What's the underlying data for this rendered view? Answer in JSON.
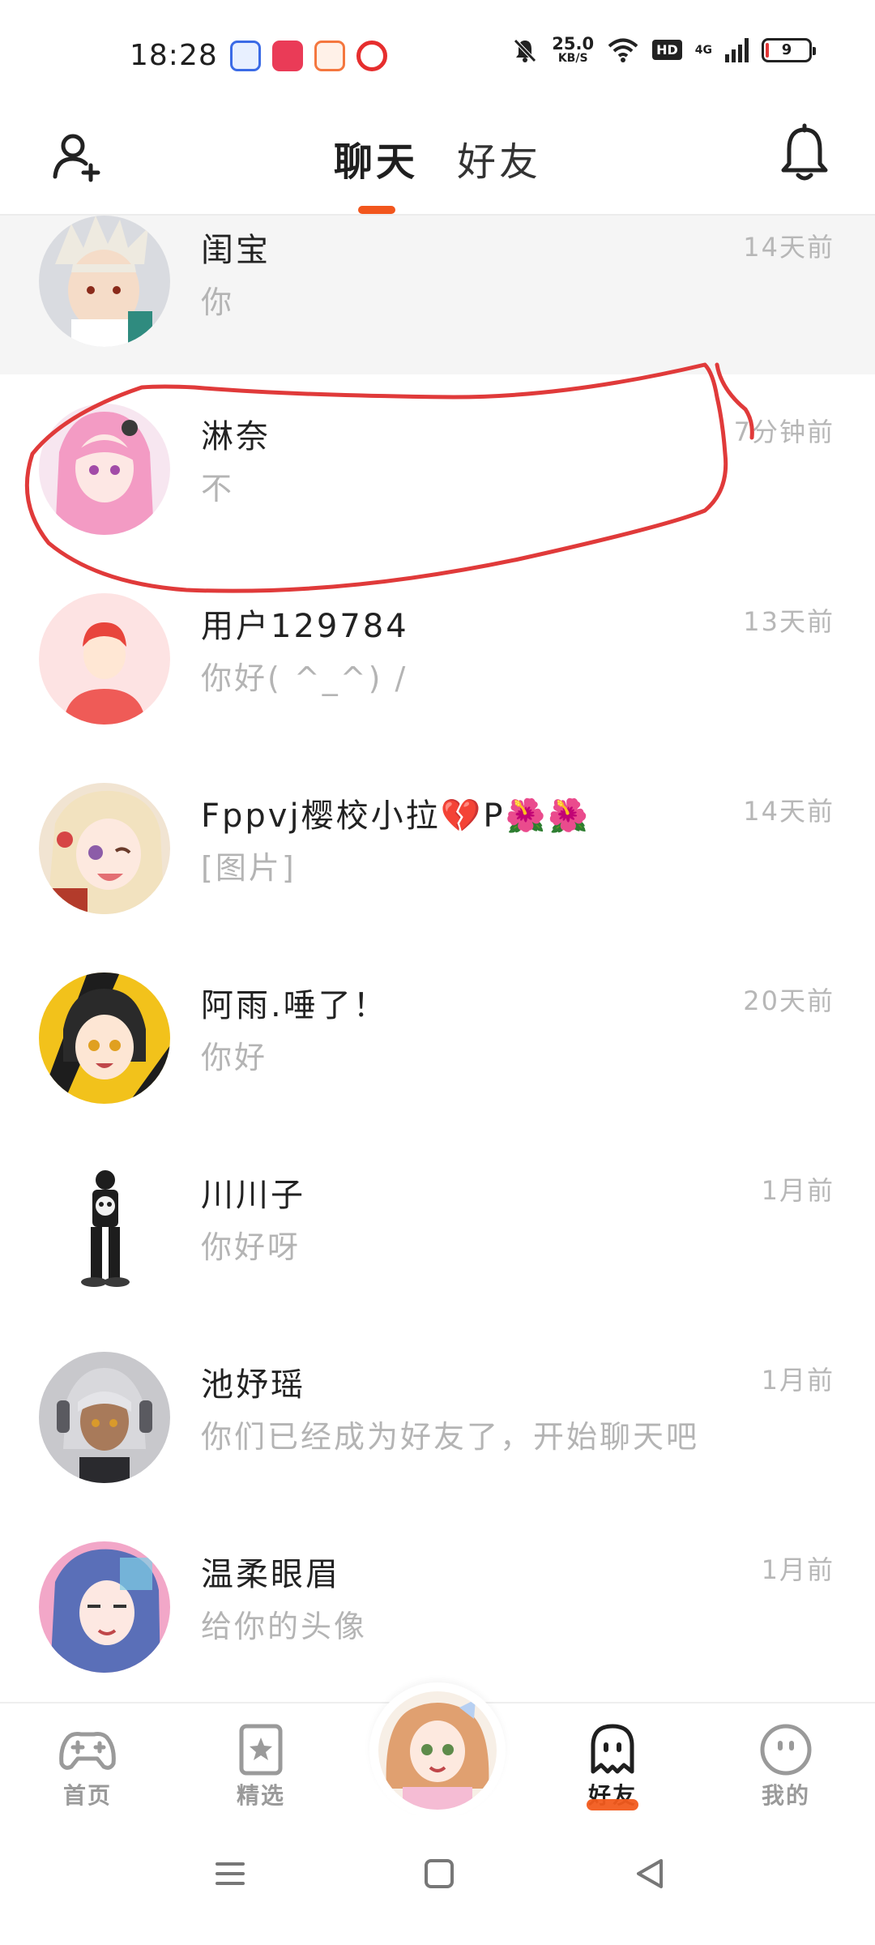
{
  "status_bar": {
    "time": "18:28",
    "speed_value": "25.0",
    "speed_unit": "KB/S",
    "hd_label": "HD",
    "network_label": "4G",
    "battery_level": "9",
    "apps": [
      "baidu-app-icon",
      "video-app-icon",
      "game-app-icon",
      "live-app-icon"
    ]
  },
  "header": {
    "tabs": [
      {
        "label": "聊天",
        "active": true
      },
      {
        "label": "好友",
        "active": false
      }
    ],
    "accent_color": "#f2561d"
  },
  "chats": [
    {
      "name": "闺宝",
      "message": "你",
      "time": "14天前",
      "pinned": true
    },
    {
      "name": "淋奈",
      "message": "不",
      "time": "7分钟前",
      "pinned": false,
      "circled": true
    },
    {
      "name": "用户129784",
      "message": "你好( ^_^) /",
      "time": "13天前",
      "pinned": false
    },
    {
      "name": "Fppvj樱校小拉💔P🌺🌺",
      "message": "[图片]",
      "time": "14天前",
      "pinned": false
    },
    {
      "name": "阿雨.唾了！",
      "message": "你好",
      "time": "20天前",
      "pinned": false
    },
    {
      "name": "川川子",
      "message": "你好呀",
      "time": "1月前",
      "pinned": false
    },
    {
      "name": "池妤瑶",
      "message": "你们已经成为好友了，开始聊天吧",
      "time": "1月前",
      "pinned": false
    },
    {
      "name": "温柔眼眉",
      "message": "给你的头像",
      "time": "1月前",
      "pinned": false
    }
  ],
  "bottom_nav": {
    "items": [
      {
        "label": "首页",
        "icon": "gamepad-icon",
        "active": false
      },
      {
        "label": "精选",
        "icon": "star-bookmark-icon",
        "active": false
      },
      {
        "label": "好友",
        "icon": "ghost-icon",
        "active": true
      },
      {
        "label": "我的",
        "icon": "smiley-icon",
        "active": false
      }
    ]
  },
  "colors": {
    "annotation_red": "#e03a3a",
    "text_muted": "#b4b4b4"
  }
}
